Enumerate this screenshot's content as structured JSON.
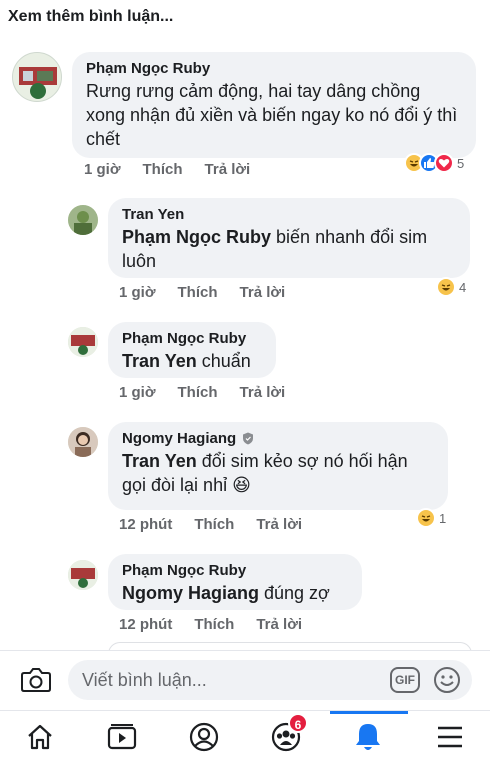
{
  "header": {
    "see_more": "Xem thêm bình luận..."
  },
  "comments": [
    {
      "author": "Phạm Ngọc Ruby",
      "mention": "",
      "text": "Rưng rưng cảm động, hai tay dâng chồng xong nhận đủ xiền và biến ngay ko nó đổi ý thì chết",
      "time": "1 giờ",
      "like_label": "Thích",
      "reply_label": "Trả lời",
      "reactions": [
        "haha",
        "like",
        "love"
      ],
      "reaction_count": "5"
    },
    {
      "author": "Tran Yen",
      "mention": "Phạm Ngọc Ruby",
      "text": " biến nhanh đổi sim luôn",
      "time": "1 giờ",
      "like_label": "Thích",
      "reply_label": "Trả lời",
      "reactions": [
        "haha"
      ],
      "reaction_count": "4"
    },
    {
      "author": "Phạm Ngọc Ruby",
      "mention": "Tran Yen",
      "text": " chuẩn",
      "time": "1 giờ",
      "like_label": "Thích",
      "reply_label": "Trả lời",
      "reactions": [],
      "reaction_count": ""
    },
    {
      "author": "Ngomy Hagiang",
      "mention": "Tran Yen",
      "text": " đổi sim kẻo sợ nó hối hận gọi đòi lại nhỉ 😆",
      "time": "12 phút",
      "like_label": "Thích",
      "reply_label": "Trả lời",
      "reactions": [
        "haha"
      ],
      "reaction_count": "1"
    },
    {
      "author": "Phạm Ngọc Ruby",
      "mention": "Ngomy Hagiang",
      "text": " đúng zợ",
      "time": "12 phút",
      "like_label": "Thích",
      "reply_label": "Trả lời",
      "reactions": [],
      "reaction_count": ""
    }
  ],
  "composer": {
    "placeholder": "Viết bình luận...",
    "gif_label": "GIF"
  },
  "tabbar": {
    "groups_badge": "6",
    "active_tab": "notifications"
  },
  "colors": {
    "accent": "#1877f2",
    "bubble": "#f0f2f5",
    "muted": "#65676b",
    "badge": "#e41e3f"
  }
}
